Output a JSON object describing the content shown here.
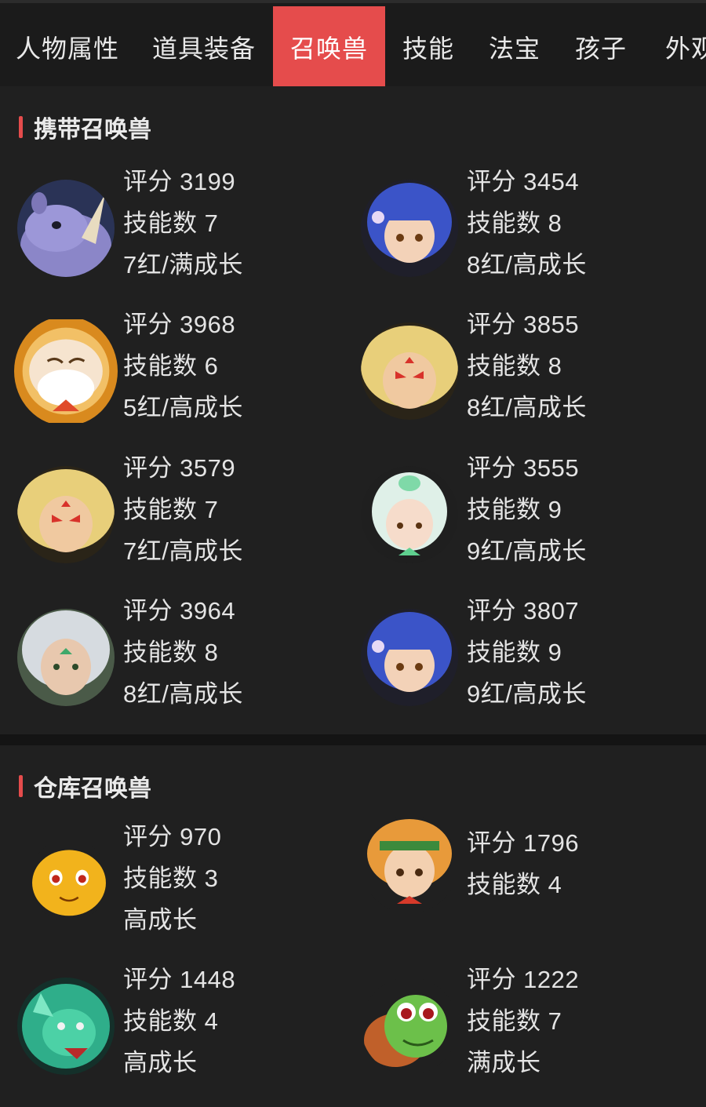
{
  "tabs": [
    {
      "label": "人物属性"
    },
    {
      "label": "道具装备"
    },
    {
      "label": "召唤兽"
    },
    {
      "label": "技能"
    },
    {
      "label": "法宝"
    },
    {
      "label": "孩子"
    },
    {
      "label": "外观"
    }
  ],
  "active_tab_index": 2,
  "sections": {
    "carried": {
      "title": "携带召唤兽",
      "pets": [
        {
          "score": "评分 3199",
          "skills": "技能数 7",
          "growth": "7红/满成长",
          "icon": "rhino-pet-icon"
        },
        {
          "score": "评分 3454",
          "skills": "技能数 8",
          "growth": "8红/高成长",
          "icon": "blue-hair-girl-pet-icon"
        },
        {
          "score": "评分 3968",
          "skills": "技能数 6",
          "growth": "5红/高成长",
          "icon": "old-sage-pet-icon"
        },
        {
          "score": "评分 3855",
          "skills": "技能数 8",
          "growth": "8红/高成长",
          "icon": "golden-hair-warrior-pet-icon"
        },
        {
          "score": "评分 3579",
          "skills": "技能数 7",
          "growth": "7红/高成长",
          "icon": "golden-hair-warrior-pet-icon"
        },
        {
          "score": "评分 3555",
          "skills": "技能数 9",
          "growth": "9红/高成长",
          "icon": "white-hair-girl-pet-icon"
        },
        {
          "score": "评分 3964",
          "skills": "技能数 8",
          "growth": "8红/高成长",
          "icon": "silver-hair-elf-pet-icon"
        },
        {
          "score": "评分 3807",
          "skills": "技能数 9",
          "growth": "9红/高成长",
          "icon": "blue-hair-girl-pet-icon"
        }
      ]
    },
    "storage": {
      "title": "仓库召唤兽",
      "pets": [
        {
          "score": "评分 970",
          "skills": "技能数 3",
          "growth": "高成长",
          "icon": "yellow-blob-pet-icon"
        },
        {
          "score": "评分 1796",
          "skills": "技能数 4",
          "growth": "",
          "icon": "monkey-boy-pet-icon"
        },
        {
          "score": "评分 1448",
          "skills": "技能数 4",
          "growth": "高成长",
          "icon": "green-dragon-pet-icon"
        },
        {
          "score": "评分 1222",
          "skills": "技能数 7",
          "growth": "满成长",
          "icon": "green-turtle-pet-icon"
        }
      ]
    }
  },
  "colors": {
    "accent": "#e54c4c",
    "background": "#202020",
    "tabbar": "#1b1b1b",
    "text": "#e4e4e4"
  }
}
